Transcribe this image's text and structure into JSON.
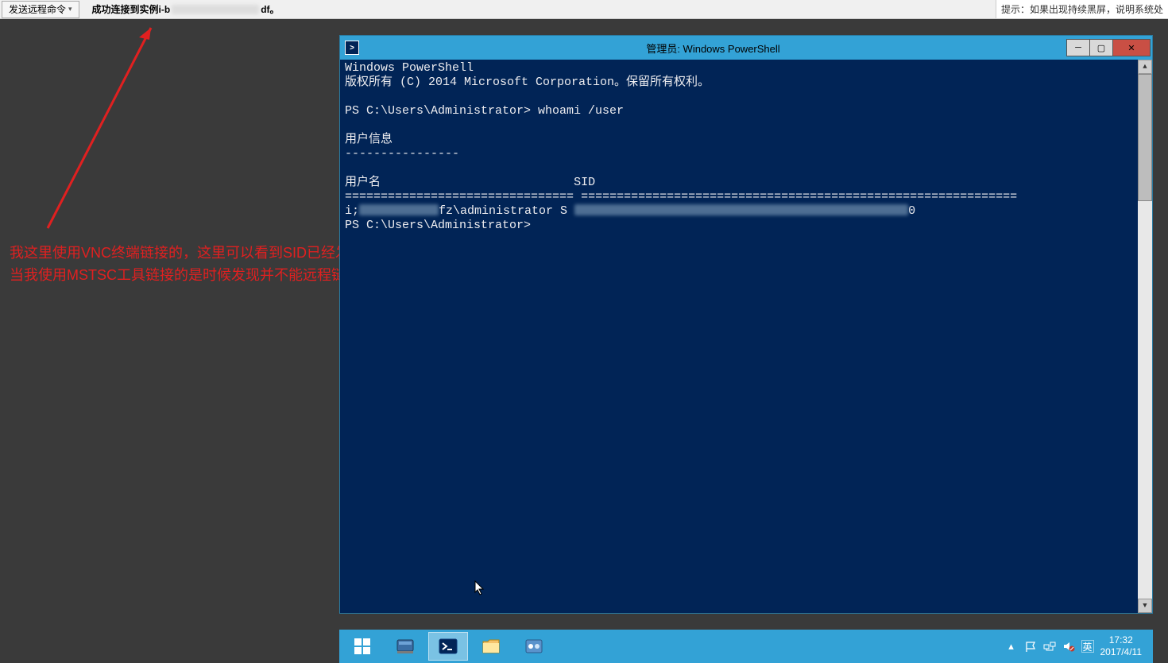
{
  "topbar": {
    "send_cmd_label": "发送远程命令",
    "status_prefix": "成功连接到实例i-b",
    "status_suffix": "df。",
    "hint_text": "提示：如果出现持续黑屏，说明系统处"
  },
  "annotation": {
    "line1": "我这里使用VNC终端链接的，这里可以看到SID已经发生改变，",
    "line2": "当我使用MSTSC工具链接的是时候发现并不能远程链接"
  },
  "powershell": {
    "title": "管理员: Windows PowerShell",
    "lines": {
      "header1": "Windows PowerShell",
      "header2": "版权所有 (C) 2014 Microsoft Corporation。保留所有权利。",
      "prompt1": "PS C:\\Users\\Administrator> whoami /user",
      "blank": "",
      "section": "用户信息",
      "dashes": "----------------",
      "col_user": "用户名",
      "col_sid": "SID",
      "sep1": "================================",
      "sep2": "=============================================================",
      "row_prefix": "i;",
      "row_mid": "fz\\administrator S",
      "row_suffix": "0",
      "prompt2": "PS C:\\Users\\Administrator>"
    }
  },
  "taskbar": {
    "time": "17:32",
    "date": "2017/4/11",
    "ime": "英",
    "chevron": "▴"
  },
  "icons": {
    "start": "start-icon",
    "server_manager": "server-manager-icon",
    "powershell": "powershell-icon",
    "explorer": "explorer-icon",
    "control": "control-panel-icon",
    "flag": "flag-icon",
    "network": "network-icon",
    "sound": "sound-muted-icon"
  }
}
